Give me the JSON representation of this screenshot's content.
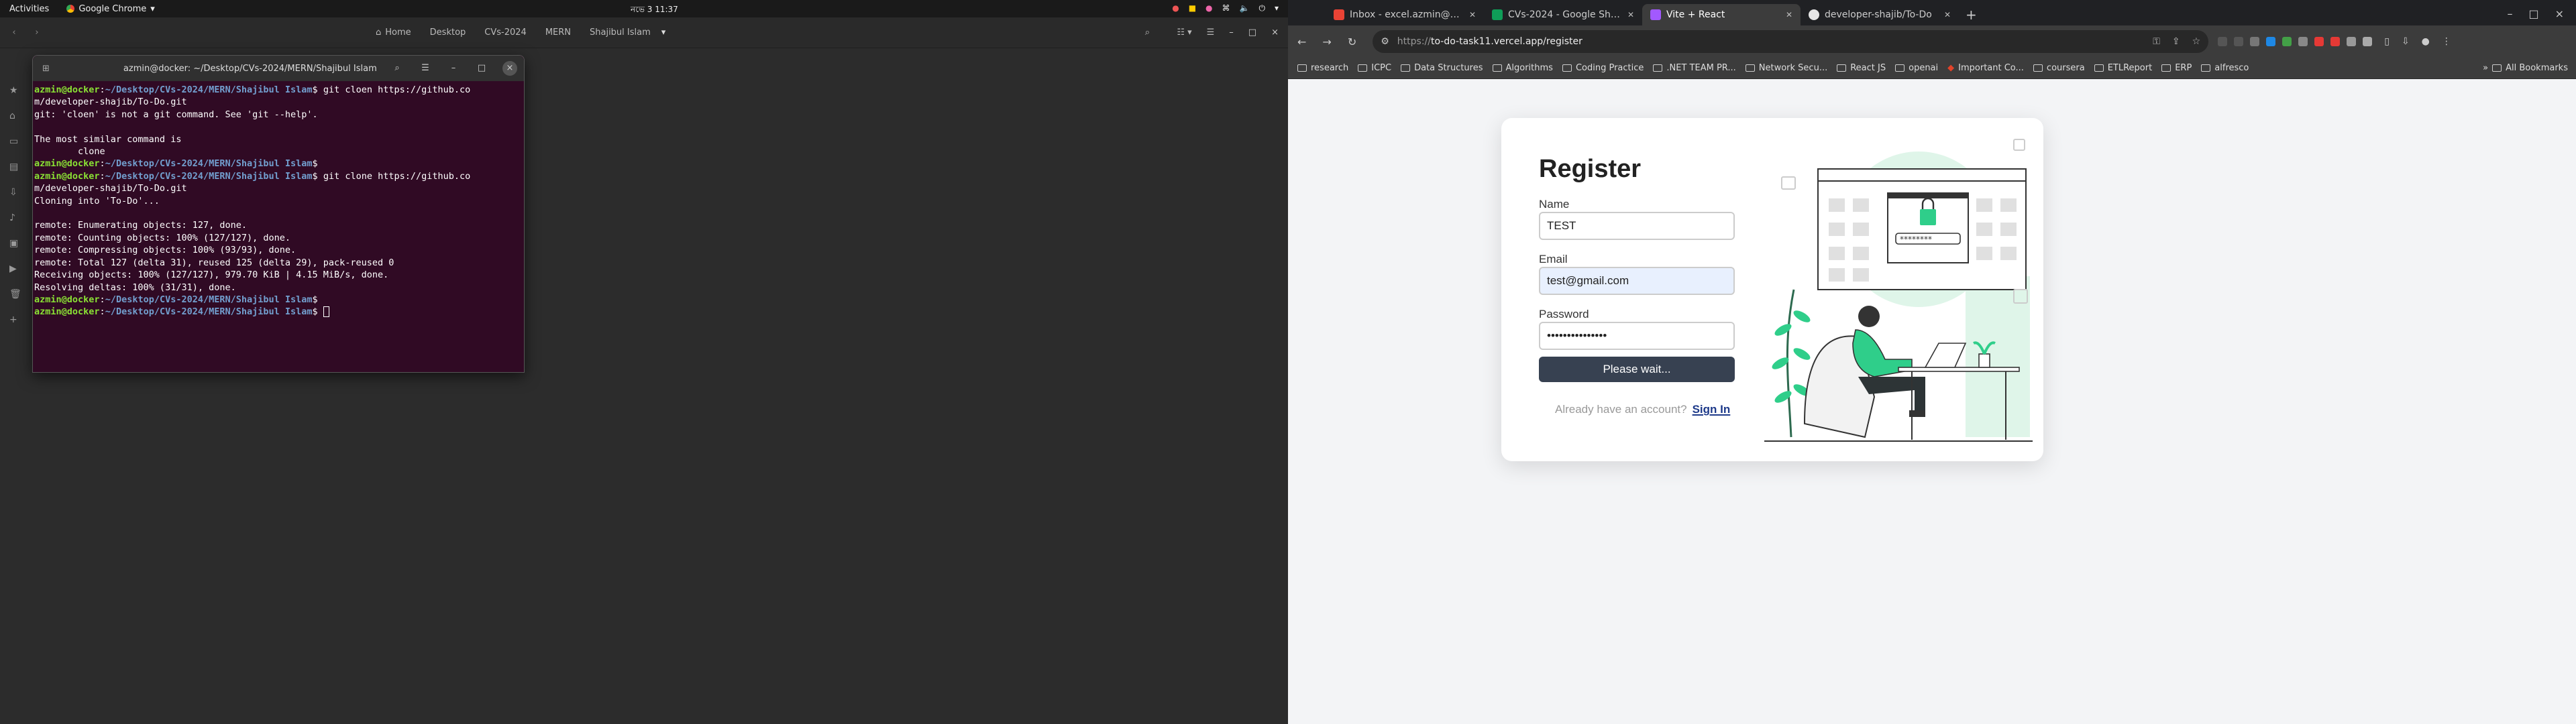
{
  "topbar": {
    "activities": "Activities",
    "app_name": "Google Chrome",
    "clock": "নভে 3  11:37"
  },
  "files": {
    "breadcrumbs": [
      "Home",
      "Desktop",
      "CVs-2024",
      "MERN",
      "Shajibul Islam"
    ]
  },
  "terminal": {
    "title": "azmin@docker: ~/Desktop/CVs-2024/MERN/Shajibul Islam",
    "user": "azmin@docker",
    "path": "~/Desktop/CVs-2024/MERN/Shajibul Islam",
    "cmd1": "git cloen https://github.co",
    "cmd1_wrap": "m/developer-shajib/To-Do.git",
    "out1": "git: 'cloen' is not a git command. See 'git --help'.",
    "out2": "The most similar command is",
    "out3": "        clone",
    "cmd2": "git clone https://github.co",
    "cmd2_wrap": "m/developer-shajib/To-Do.git",
    "out4": "Cloning into 'To-Do'...",
    "out5": "remote: Enumerating objects: 127, done.",
    "out6": "remote: Counting objects: 100% (127/127), done.",
    "out7": "remote: Compressing objects: 100% (93/93), done.",
    "out8": "remote: Total 127 (delta 31), reused 125 (delta 29), pack-reused 0",
    "out9": "Receiving objects: 100% (127/127), 979.70 KiB | 4.15 MiB/s, done.",
    "out10": "Resolving deltas: 100% (31/31), done."
  },
  "chrome": {
    "tabs": [
      {
        "label": "Inbox - excel.azmin@gm",
        "color": "#ea4335"
      },
      {
        "label": "CVs-2024 - Google Shee",
        "color": "#0f9d58"
      },
      {
        "label": "Vite + React",
        "color": "#a259ff"
      },
      {
        "label": "developer-shajib/To-Do",
        "color": "#e6e6e6"
      }
    ],
    "url_prefix": "https://",
    "url": "to-do-task11.vercel.app/register",
    "bookmarks": [
      "research",
      "ICPC",
      "Data Structures",
      "Algorithms",
      "Coding Practice",
      ".NET TEAM PR...",
      "Network Secu...",
      "React JS",
      "openai",
      "Important Co...",
      "coursera",
      "ETLReport",
      "ERP",
      "alfresco"
    ],
    "all_bookmarks": "All Bookmarks"
  },
  "register": {
    "title": "Register",
    "name_label": "Name",
    "name_value": "TEST",
    "email_label": "Email",
    "email_value": "test@gmail.com",
    "password_label": "Password",
    "password_value": "•••••••••••••••",
    "submit": "Please wait...",
    "signin_prompt": "Already have an account?",
    "signin_link": "Sign In"
  },
  "colors": {
    "terminal_bg": "#300a24",
    "button": "#374151",
    "accent": "#2fce8a"
  }
}
